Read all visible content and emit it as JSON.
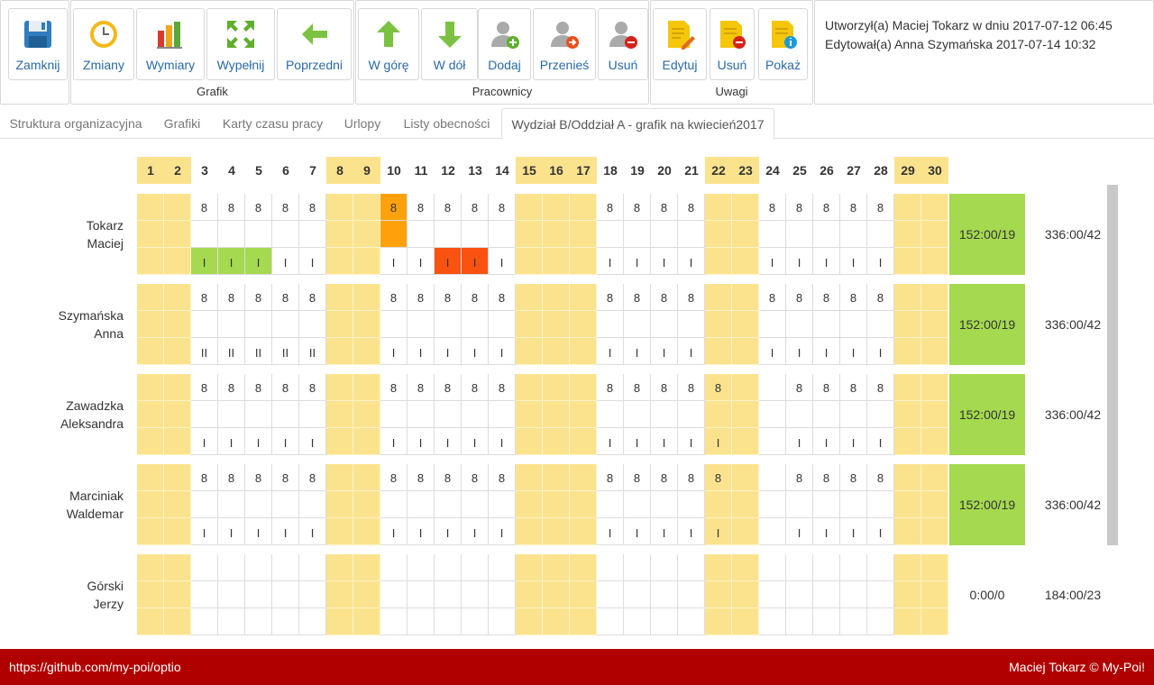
{
  "toolbar": {
    "groups": [
      {
        "label": "",
        "buttons": [
          {
            "label": "Zamknij",
            "icon": "save-icon"
          }
        ]
      },
      {
        "label": "Grafik",
        "buttons": [
          {
            "label": "Zmiany",
            "icon": "clock-icon"
          },
          {
            "label": "Wymiary",
            "icon": "bar-chart-icon"
          },
          {
            "label": "Wypełnij",
            "icon": "expand-icon"
          },
          {
            "label": "Poprzedni",
            "icon": "arrow-left-icon"
          }
        ]
      },
      {
        "label": "Pracownicy",
        "buttons": [
          {
            "label": "W górę",
            "icon": "arrow-up-icon"
          },
          {
            "label": "W dół",
            "icon": "arrow-down-icon"
          },
          {
            "label": "Dodaj",
            "icon": "user-add-icon"
          },
          {
            "label": "Przenieś",
            "icon": "user-move-icon"
          },
          {
            "label": "Usuń",
            "icon": "user-remove-icon"
          }
        ]
      },
      {
        "label": "Uwagi",
        "buttons": [
          {
            "label": "Edytuj",
            "icon": "note-edit-icon"
          },
          {
            "label": "Usuń",
            "icon": "note-remove-icon"
          },
          {
            "label": "Pokaż",
            "icon": "note-info-icon"
          }
        ]
      }
    ]
  },
  "info": {
    "created": "Utworzył(a) Maciej Tokarz w dniu 2017-07-12 06:45",
    "edited": "Edytował(a) Anna Szymańska 2017-07-14 10:32"
  },
  "tabs": [
    {
      "label": "Struktura organizacyjna",
      "active": false
    },
    {
      "label": "Grafiki",
      "active": false
    },
    {
      "label": "Karty czasu pracy",
      "active": false
    },
    {
      "label": "Urlopy",
      "active": false
    },
    {
      "label": "Listy obecności",
      "active": false
    },
    {
      "label": "Wydział B/Oddział A - grafik na kwiecień2017",
      "active": true
    }
  ],
  "schedule": {
    "days": [
      1,
      2,
      3,
      4,
      5,
      6,
      7,
      8,
      9,
      10,
      11,
      12,
      13,
      14,
      15,
      16,
      17,
      18,
      19,
      20,
      21,
      22,
      23,
      24,
      25,
      26,
      27,
      28,
      29,
      30
    ],
    "weekend_days": [
      1,
      2,
      8,
      9,
      15,
      16,
      17,
      22,
      23,
      29,
      30
    ],
    "employees": [
      {
        "first": "Tokarz",
        "second": "Maciej",
        "hours": {
          "3": "8",
          "4": "8",
          "5": "8",
          "6": "8",
          "7": "8",
          "10": "8",
          "11": "8",
          "12": "8",
          "13": "8",
          "14": "8",
          "18": "8",
          "19": "8",
          "20": "8",
          "21": "8",
          "24": "8",
          "25": "8",
          "26": "8",
          "27": "8",
          "28": "8"
        },
        "shifts": {
          "3": "I",
          "4": "I",
          "5": "I",
          "6": "I",
          "7": "I",
          "10": "I",
          "11": "I",
          "12": "I",
          "13": "I",
          "14": "I",
          "18": "I",
          "19": "I",
          "20": "I",
          "21": "I",
          "24": "I",
          "25": "I",
          "26": "I",
          "27": "I",
          "28": "I"
        },
        "highlights": {
          "row0": {
            "10": "o"
          },
          "row1": {
            "10": "o"
          },
          "row2": {
            "3": "g",
            "4": "g",
            "5": "g",
            "12": "r",
            "13": "r"
          }
        },
        "summary": "152:00/19",
        "summary_full": true,
        "total": "336:00/42"
      },
      {
        "first": "Szymańska",
        "second": "Anna",
        "hours": {
          "3": "8",
          "4": "8",
          "5": "8",
          "6": "8",
          "7": "8",
          "10": "8",
          "11": "8",
          "12": "8",
          "13": "8",
          "14": "8",
          "18": "8",
          "19": "8",
          "20": "8",
          "21": "8",
          "24": "8",
          "25": "8",
          "26": "8",
          "27": "8",
          "28": "8"
        },
        "shifts": {
          "3": "II",
          "4": "II",
          "5": "II",
          "6": "II",
          "7": "II",
          "10": "I",
          "11": "I",
          "12": "I",
          "13": "I",
          "14": "I",
          "18": "I",
          "19": "I",
          "20": "I",
          "21": "I",
          "24": "I",
          "25": "I",
          "26": "I",
          "27": "I",
          "28": "I"
        },
        "highlights": {},
        "summary": "152:00/19",
        "summary_full": true,
        "total": "336:00/42"
      },
      {
        "first": "Zawadzka",
        "second": "Aleksandra",
        "hours": {
          "3": "8",
          "4": "8",
          "5": "8",
          "6": "8",
          "7": "8",
          "10": "8",
          "11": "8",
          "12": "8",
          "13": "8",
          "14": "8",
          "18": "8",
          "19": "8",
          "20": "8",
          "21": "8",
          "22": "8",
          "25": "8",
          "26": "8",
          "27": "8",
          "28": "8"
        },
        "shifts": {
          "3": "I",
          "4": "I",
          "5": "I",
          "6": "I",
          "7": "I",
          "10": "I",
          "11": "I",
          "12": "I",
          "13": "I",
          "14": "I",
          "18": "I",
          "19": "I",
          "20": "I",
          "21": "I",
          "22": "I",
          "25": "I",
          "26": "I",
          "27": "I",
          "28": "I"
        },
        "highlights": {},
        "summary": "152:00/19",
        "summary_full": true,
        "total": "336:00/42"
      },
      {
        "first": "Marciniak",
        "second": "Waldemar",
        "hours": {
          "3": "8",
          "4": "8",
          "5": "8",
          "6": "8",
          "7": "8",
          "10": "8",
          "11": "8",
          "12": "8",
          "13": "8",
          "14": "8",
          "18": "8",
          "19": "8",
          "20": "8",
          "21": "8",
          "22": "8",
          "25": "8",
          "26": "8",
          "27": "8",
          "28": "8"
        },
        "shifts": {
          "3": "I",
          "4": "I",
          "5": "I",
          "6": "I",
          "7": "I",
          "10": "I",
          "11": "I",
          "12": "I",
          "13": "I",
          "14": "I",
          "18": "I",
          "19": "I",
          "20": "I",
          "21": "I",
          "22": "I",
          "25": "I",
          "26": "I",
          "27": "I",
          "28": "I"
        },
        "highlights": {},
        "summary": "152:00/19",
        "summary_full": true,
        "total": "336:00/42"
      },
      {
        "first": "Górski",
        "second": "Jerzy",
        "hours": {},
        "shifts": {},
        "highlights": {},
        "summary": "0:00/0",
        "summary_full": false,
        "total": "184:00/23"
      }
    ]
  },
  "colors": {
    "weekend": "#fbe38e",
    "summary_full": "#a5d94f",
    "highlight_green": "#a5d94f",
    "highlight_orange": "#ffa10a",
    "highlight_red": "#fa5210",
    "footer": "#b00000",
    "button_text": "#2a6aa6"
  },
  "footer": {
    "left": "https://github.com/my-poi/optio",
    "right": "Maciej Tokarz © My-Poi!"
  }
}
